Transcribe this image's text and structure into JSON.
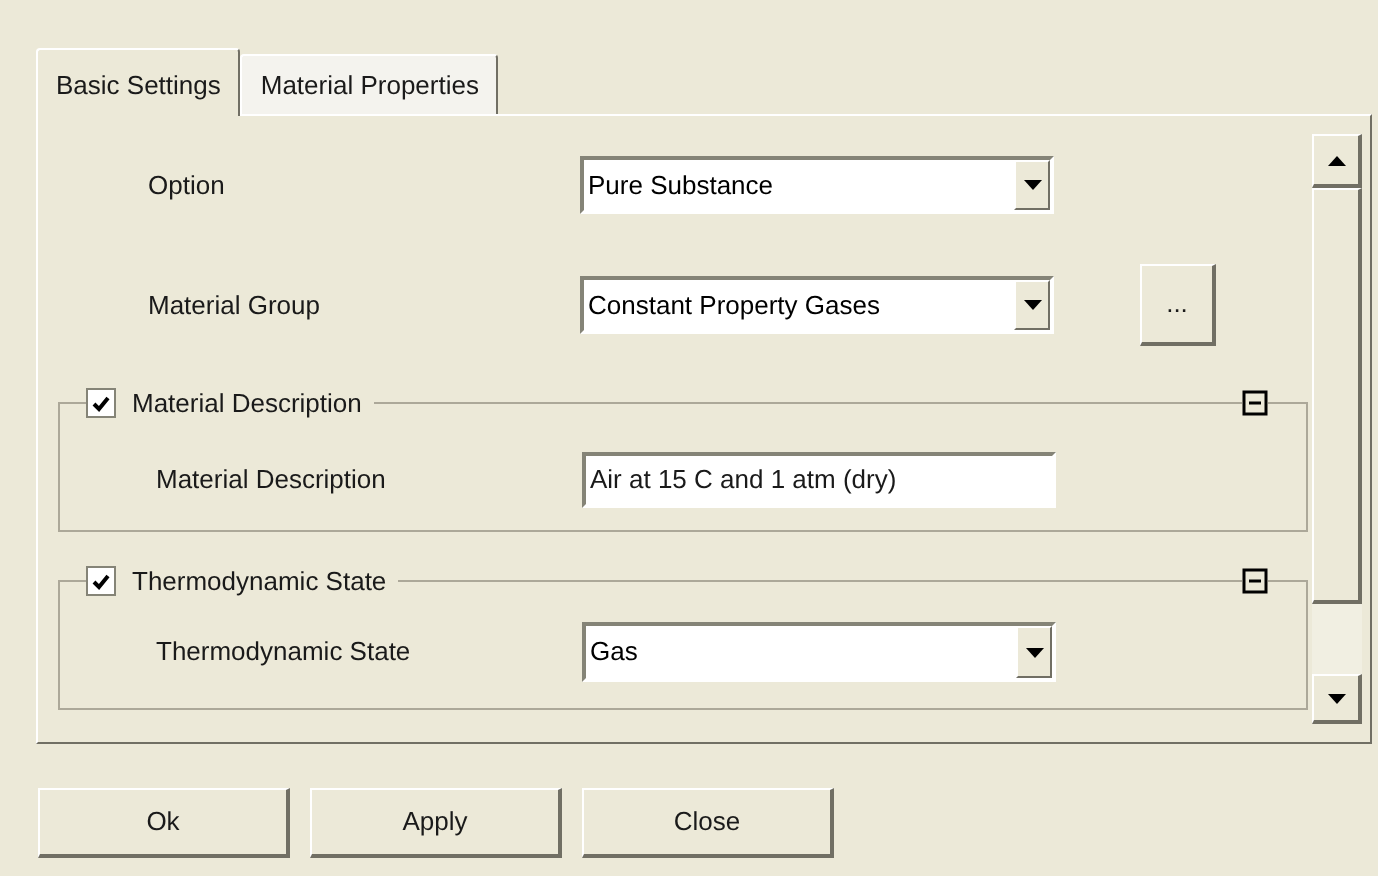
{
  "tabs": [
    {
      "label": "Basic Settings",
      "selected": true
    },
    {
      "label": "Material Properties",
      "selected": false
    }
  ],
  "fields": [
    {
      "label": "Option",
      "kind": "dropdown",
      "value": "Pure Substance"
    },
    {
      "label": "Material Group",
      "kind": "dropdown",
      "value": "Constant Property Gases",
      "button": "..."
    }
  ],
  "groups": [
    {
      "title": "Material Description",
      "checked": true,
      "expanded": true,
      "fields": [
        {
          "label": "Material Description",
          "kind": "text",
          "value": "Air at 15 C and 1 atm (dry)"
        }
      ]
    },
    {
      "title": "Thermodynamic State",
      "checked": true,
      "expanded": true,
      "fields": [
        {
          "label": "Thermodynamic State",
          "kind": "dropdown",
          "value": "Gas"
        }
      ]
    }
  ],
  "buttons": [
    "Ok",
    "Apply",
    "Close"
  ]
}
